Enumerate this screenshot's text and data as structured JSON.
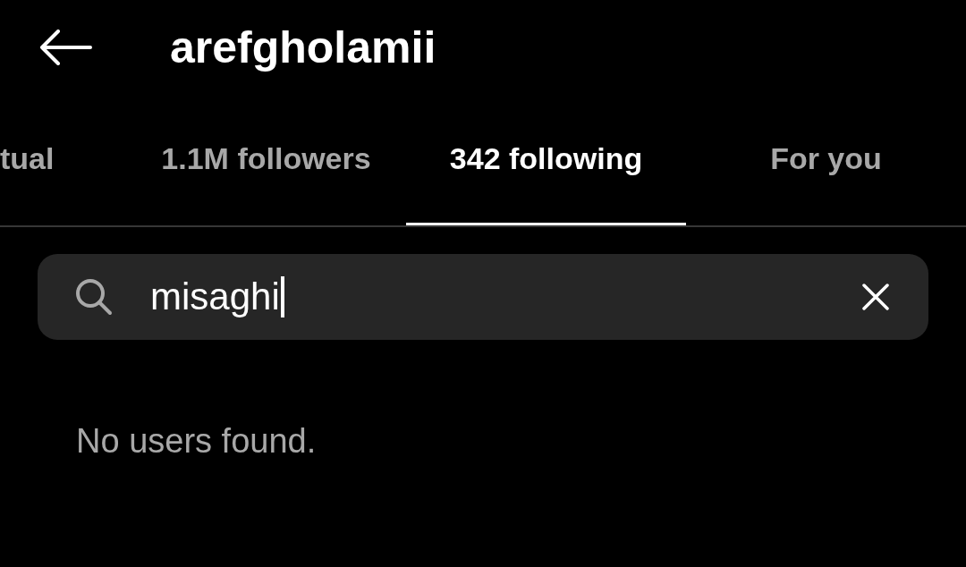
{
  "header": {
    "title": "arefgholamii"
  },
  "tabs": [
    {
      "label": "tual",
      "selected": false
    },
    {
      "label": "1.1M followers",
      "selected": false
    },
    {
      "label": "342 following",
      "selected": true
    },
    {
      "label": "For you",
      "selected": false
    }
  ],
  "search": {
    "value": "misaghi"
  },
  "message": "No users found."
}
